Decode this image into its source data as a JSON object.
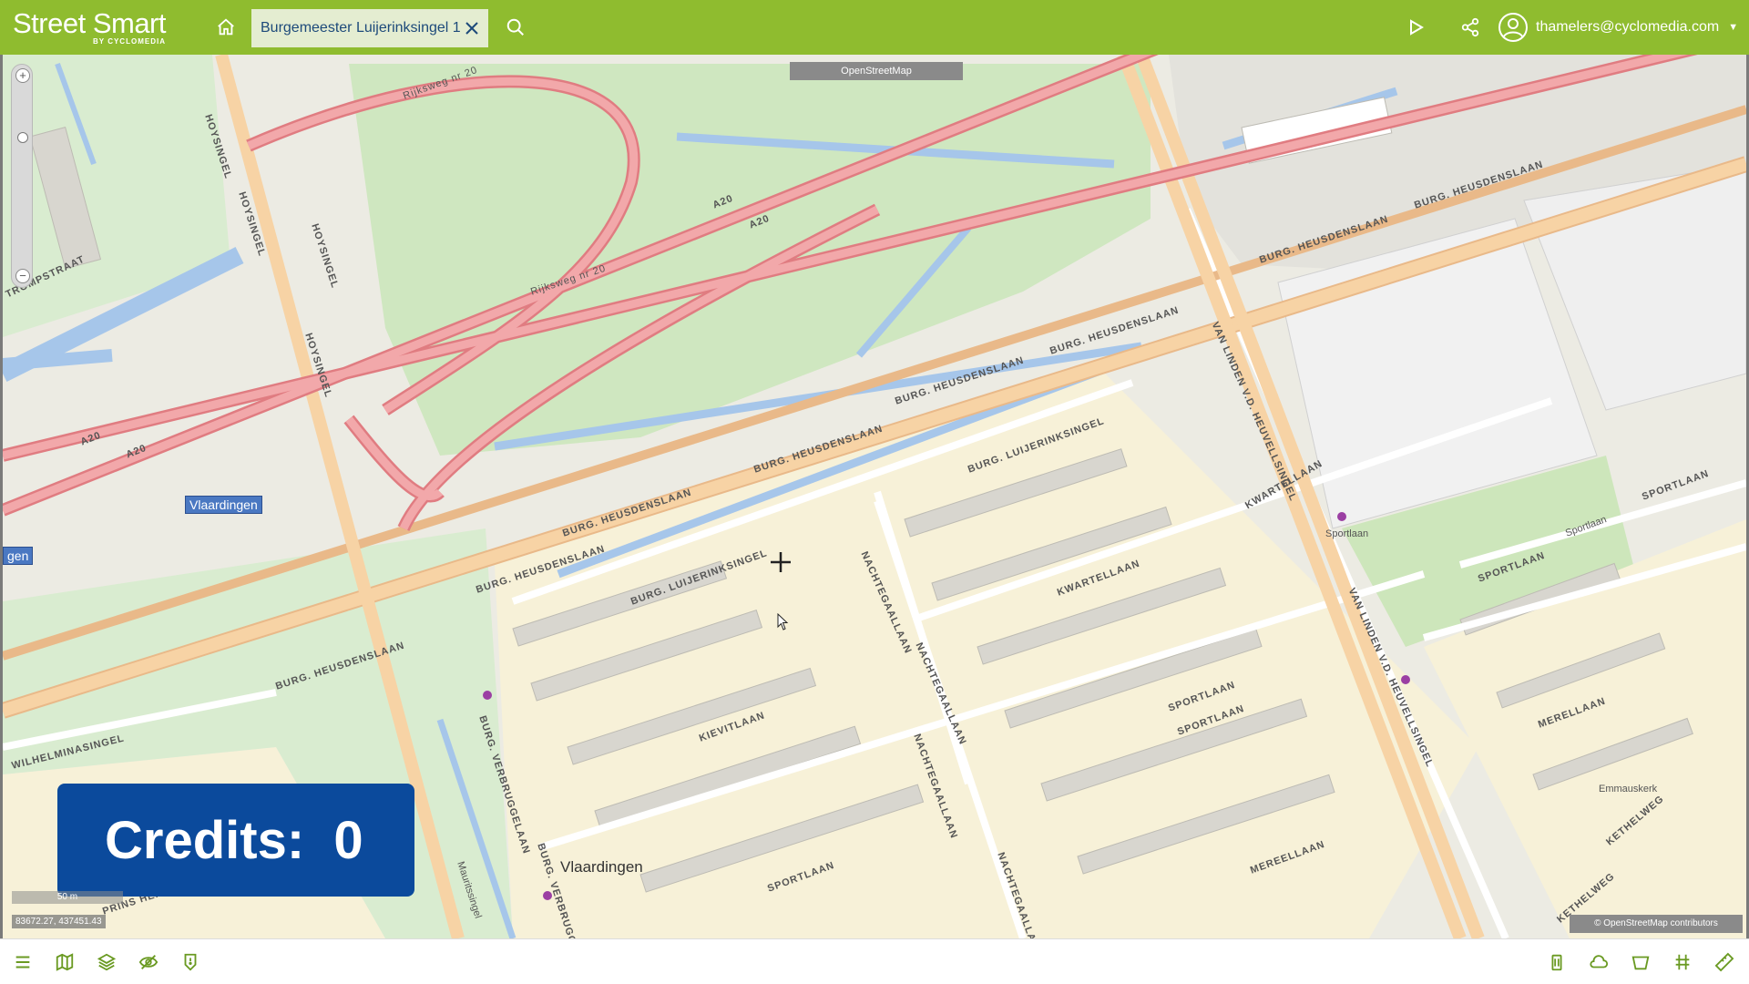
{
  "app": {
    "brand_name": "Street Smart",
    "brand_sub": "BY CYCLOMEDIA"
  },
  "header": {
    "tab_label": "Burgemeester Luijerinksingel 1",
    "user_email": "thamelers@cyclomedia.com"
  },
  "map": {
    "source_badge": "OpenStreetMap",
    "place_badge": "Vlaardingen",
    "place_badge_left": "gen",
    "city_label": "Vlaardingen",
    "scale_label": "50 m",
    "coordinates": "83672.27, 437451.43",
    "attribution": "© OpenStreetMap contributors",
    "street_labels": {
      "a20_1": "A20",
      "a20_2": "A20",
      "a20_3": "A20",
      "a20_4": "A20",
      "rijksweg": "Rijksweg nr 20",
      "rijksweg_2": "Rijksweg nr 20",
      "hoysingel_1": "HOYSINGEL",
      "hoysingel_2": "HOYSINGEL",
      "hoysingel_3": "HOYSINGEL",
      "hoysingel_4": "HOYSINGEL",
      "heusdenslaan_1": "BURG. HEUSDENSLAAN",
      "heusdenslaan_2": "BURG. HEUSDENSLAAN",
      "heusdenslaan_3": "BURG. HEUSDENSLAAN",
      "heusdenslaan_4": "BURG. HEUSDENSLAAN",
      "heusdenslaan_5": "BURG. HEUSDENSLAAN",
      "heusdenslaan_6": "BURG. HEUSDENSLAAN",
      "heusdenslaan_7": "BURG. HEUSDENSLAAN",
      "heusdenslaan_8": "BURG. HEUSDENSLAAN",
      "luijerinksingel_1": "BURG. LUIJERINKSINGEL",
      "luijerinksingel_2": "BURG. LUIJERINKSINGEL",
      "van_linden_1": "VAN LINDEN V.D. HEUVELLSINGEL",
      "van_linden_2": "VAN LINDEN V.D. HEUVELLSINGEL",
      "kwartellaan_1": "KWARTELLAAN",
      "kwartellaan_2": "KWARTELLAAN",
      "nachtegaallaan_1": "NACHTEGAALLAAN",
      "nachtegaallaan_2": "NACHTEGAALLAAN",
      "nachtegaallaan_3": "NACHTEGAALLAAN",
      "nachtegaallaan_4": "NACHTEGAALLAAN",
      "kievitlaan": "KIEVITLAAN",
      "sportlaan_1": "SPORTLAAN",
      "sportlaan_2": "SPORTLAAN",
      "sportlaan_3": "SPORTLAAN",
      "sportlaan_4": "SPORTLAAN",
      "sportlaan_5": "SPORTLAAN",
      "meteelaan": "MEREELLAAN",
      "merellaan": "MERELLAAN",
      "wilhelminasingel": "WILHELMINASINGEL",
      "trompstraat": "TROMPSTRAAT",
      "prins_hendriklaan": "PRINS HENDRIKLAAN",
      "verbrugge_1": "BURG. VERBRUGGELAAN",
      "verbrugge_2": "BURG. VERBRUGGELAAN",
      "kethelweg_1": "KETHELWEG",
      "kethelweg_2": "KETHELWEG",
      "sportlaan_poi": "Sportlaan",
      "sportlaan_poi_2": "Sportlaan",
      "emmauskerk": "Emmauskerk",
      "mauritssingel": "Mauritssingel"
    }
  },
  "overlay": {
    "credits": "Credits:  0"
  },
  "colors": {
    "header_bg": "#8fbc2f",
    "tab_bg": "#e4edd1",
    "credits_bg": "#0b4a9c",
    "motorway": "#e8898c",
    "primary_road": "#f5c98e",
    "water": "#a6c6ea",
    "park": "#cce6b5"
  },
  "icons": {
    "home": "home-icon",
    "close": "close-icon",
    "search": "search-icon",
    "play": "play-icon",
    "share": "share-icon",
    "user": "user-icon",
    "menu": "menu-icon",
    "map": "map-icon",
    "layers": "layers-icon",
    "visibility": "eye-off-icon",
    "marker": "marker-icon",
    "trash": "trash-icon",
    "cloud": "cloud-icon",
    "area": "area-icon",
    "grid": "grid-icon",
    "ruler": "ruler-icon"
  }
}
